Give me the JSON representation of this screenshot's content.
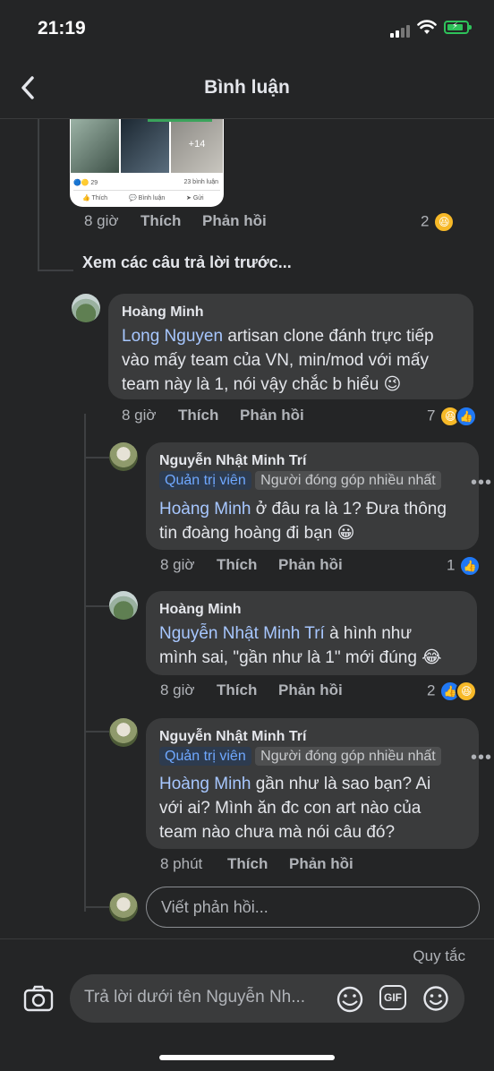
{
  "status_bar": {
    "time": "21:19"
  },
  "header": {
    "title": "Bình luận"
  },
  "preview_card": {
    "more_count": "+14",
    "reaction_count": "29",
    "comments_label": "23 bình luận",
    "like_label": "Thích",
    "comment_label": "Bình luận",
    "send_label": "Gửi"
  },
  "top_comment_meta": {
    "time": "8 giờ",
    "like": "Thích",
    "reply": "Phản hồi",
    "reactions": "2"
  },
  "view_previous": "Xem các câu trả lời trước...",
  "comments": [
    {
      "author": "Hoàng Minh",
      "mention": "Long Nguyen",
      "lines": [
        " artisan clone đánh trực tiếp",
        "vào mấy team của VN, min/mod với mấy",
        "team này là 1, nói vậy chắc b hiểu 😉"
      ],
      "time": "8 giờ",
      "like": "Thích",
      "reply": "Phản hồi",
      "reactions": "7"
    },
    {
      "author": "Nguyễn Nhật Minh Trí",
      "badges": [
        "Quản trị viên",
        "Người đóng góp nhiều nhất"
      ],
      "mention": "Hoàng Minh",
      "lines": [
        " ở đâu ra là 1? Đưa thông",
        "tin đoàng hoàng đi bạn 😀"
      ],
      "time": "8 giờ",
      "like": "Thích",
      "reply": "Phản hồi",
      "reactions": "1"
    },
    {
      "author": "Hoàng Minh",
      "mention": "Nguyễn Nhật Minh Trí",
      "lines": [
        " à hình như",
        "mình sai, \"gần như là 1\" mới đúng 😂"
      ],
      "time": "8 giờ",
      "like": "Thích",
      "reply": "Phản hồi",
      "reactions": "2"
    },
    {
      "author": "Nguyễn Nhật Minh Trí",
      "badges": [
        "Quản trị viên",
        "Người đóng góp nhiều nhất"
      ],
      "mention": "Hoàng Minh",
      "lines": [
        " gần như là sao bạn? Ai",
        "với ai? Mình ăn đc con art nào của",
        "team nào chưa mà nói câu đó?"
      ],
      "time": "8 phút",
      "like": "Thích",
      "reply": "Phản hồi"
    }
  ],
  "reply_input": {
    "placeholder": "Viết phản hồi..."
  },
  "footer": {
    "rules": "Quy tắc",
    "composer_placeholder": "Trả lời dưới tên Nguyễn Nh...",
    "gif_label": "GIF"
  }
}
